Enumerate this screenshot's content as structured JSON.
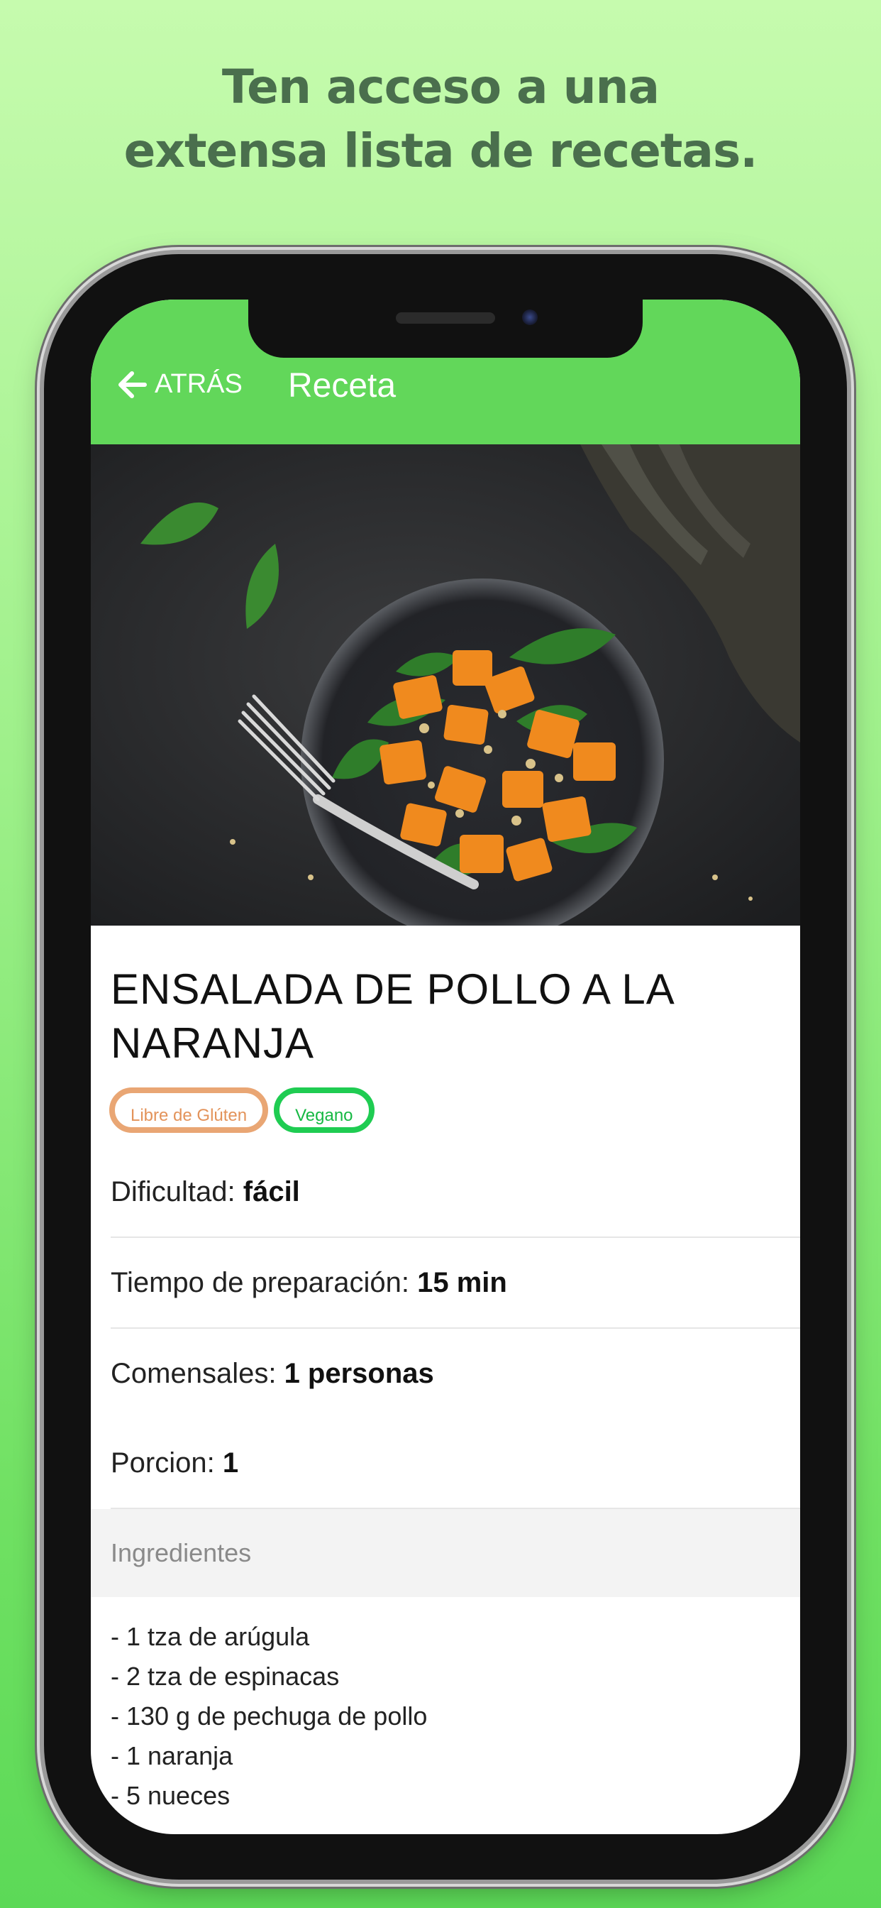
{
  "headline": {
    "line1": "Ten acceso a una",
    "line2": "extensa lista de recetas."
  },
  "navbar": {
    "back_label": "ATRÁS",
    "title": "Receta"
  },
  "recipe": {
    "title": "ENSALADA DE POLLO A LA NARANJA",
    "tags": [
      "Libre de Glúten",
      "Vegano"
    ],
    "details": {
      "difficulty_label": "Dificultad:",
      "difficulty_value": "fácil",
      "prep_label": "Tiempo de preparación:",
      "prep_value": "15 min",
      "diners_label": "Comensales:",
      "diners_value": "1 personas",
      "portion_label": "Porcion:",
      "portion_value": "1"
    },
    "ingredients_header": "Ingredientes",
    "ingredients": [
      "- 1 tza de arúgula",
      "- 2 tza de espinacas",
      "- 130 g de pechuga de pollo",
      "- 1 naranja",
      "- 5 nueces"
    ]
  },
  "colors": {
    "brand_green": "#62d75a",
    "tag_gluten": "#e9a674",
    "tag_vegan": "#1fcc52"
  },
  "icons": {
    "back": "arrow-left-icon"
  }
}
